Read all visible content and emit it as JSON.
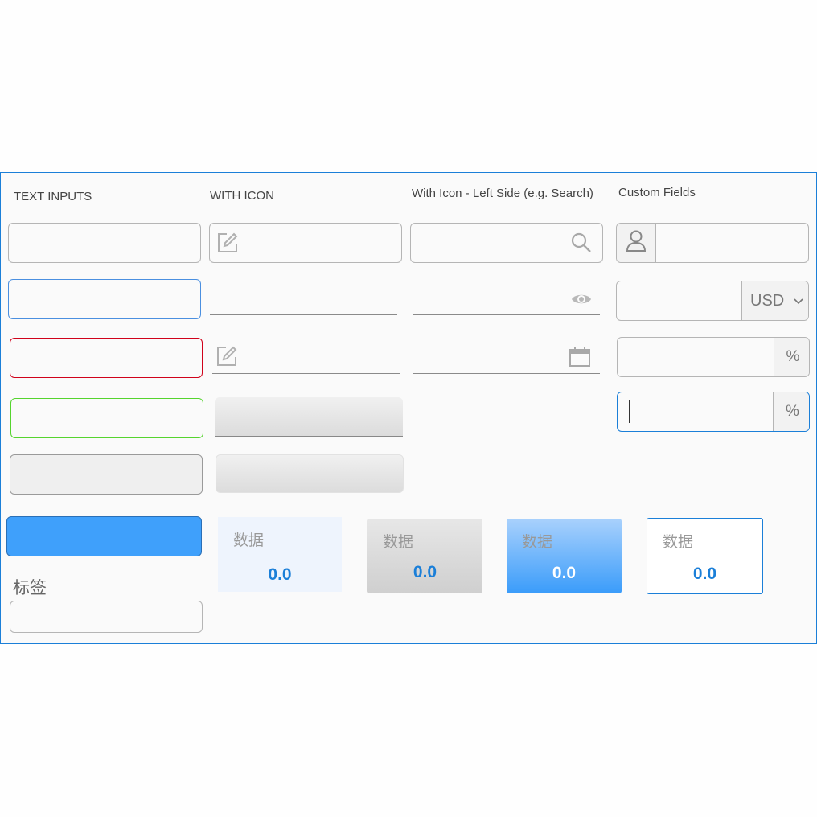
{
  "headers": {
    "text_inputs": "TEXT INPUTS",
    "with_icon": "WITH ICON",
    "with_icon_left": "With Icon - Left Side (e.g. Search)",
    "custom_fields": "Custom Fields"
  },
  "icons": {
    "edit": "edit-icon",
    "search": "search-icon",
    "eye": "eye-icon",
    "calendar": "calendar-icon",
    "user": "user-icon",
    "chevron": "chevron-down-icon"
  },
  "custom": {
    "currency": "USD",
    "percent_1": "%",
    "percent_2": "%"
  },
  "label_field": {
    "label": "标签"
  },
  "cards": [
    {
      "label": "数据",
      "value": "0.0"
    },
    {
      "label": "数据",
      "value": "0.0"
    },
    {
      "label": "数据",
      "value": "0.0"
    },
    {
      "label": "数据",
      "value": "0.0"
    }
  ],
  "colors": {
    "accent": "#1b7fd8",
    "error": "#d0021b",
    "success": "#55d42e",
    "primary_fill": "#3fa0fb"
  }
}
